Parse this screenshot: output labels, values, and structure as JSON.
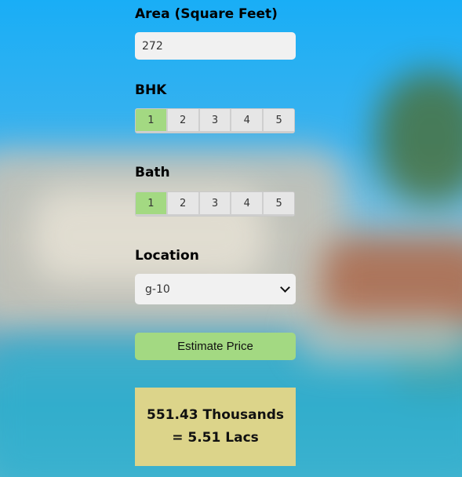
{
  "area": {
    "label": "Area (Square Feet)",
    "value": "272"
  },
  "bhk": {
    "label": "BHK",
    "options": [
      "1",
      "2",
      "3",
      "4",
      "5"
    ],
    "selected": "1"
  },
  "bath": {
    "label": "Bath",
    "options": [
      "1",
      "2",
      "3",
      "4",
      "5"
    ],
    "selected": "1"
  },
  "location": {
    "label": "Location",
    "selected": "g-10"
  },
  "estimate_button": {
    "label": "Estimate Price"
  },
  "result": {
    "line1": "551.43 Thousands",
    "line2": "= 5.51 Lacs"
  },
  "colors": {
    "active_toggle": "#a3d982",
    "button": "#a3d982",
    "result_bg": "#dcd48a",
    "field_bg": "#f1f1f1"
  }
}
